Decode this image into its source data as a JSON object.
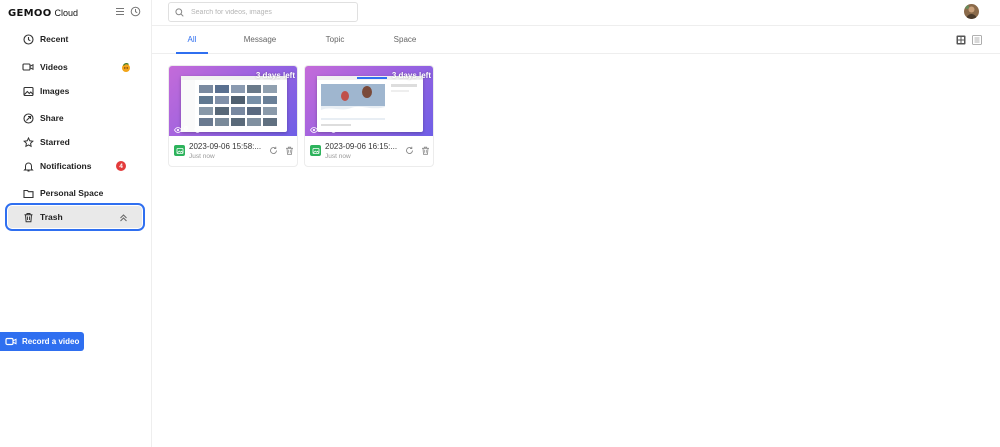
{
  "brand": {
    "logo_text": "GEMOO",
    "product": "Cloud"
  },
  "sidebar": {
    "items": [
      {
        "label": "Recent",
        "icon": "clock-icon"
      },
      {
        "label": "Videos",
        "icon": "video-icon"
      },
      {
        "label": "Images",
        "icon": "image-icon"
      },
      {
        "label": "Share",
        "icon": "share-icon"
      },
      {
        "label": "Starred",
        "icon": "star-icon"
      },
      {
        "label": "Notifications",
        "icon": "bell-icon",
        "badge": "4"
      },
      {
        "label": "Personal Space",
        "icon": "folder-icon"
      },
      {
        "label": "Trash",
        "icon": "trash-icon",
        "selected": true
      }
    ],
    "record_label": "Record a video"
  },
  "search": {
    "placeholder": "Search for videos, images",
    "value": ""
  },
  "tabs": [
    {
      "label": "All",
      "active": true
    },
    {
      "label": "Message"
    },
    {
      "label": "Topic"
    },
    {
      "label": "Space"
    }
  ],
  "cards": [
    {
      "title": "2023-09-06 15:58:...",
      "time": "Just now",
      "days_left": "3 days left",
      "views": "0",
      "comments": "0"
    },
    {
      "title": "2023-09-06 16:15:...",
      "time": "Just now",
      "days_left": "3 days left",
      "views": "0",
      "comments": "0"
    }
  ],
  "colors": {
    "accent": "#2f6ff0",
    "badge": "#e33b3b",
    "file_icon": "#2db35c"
  }
}
